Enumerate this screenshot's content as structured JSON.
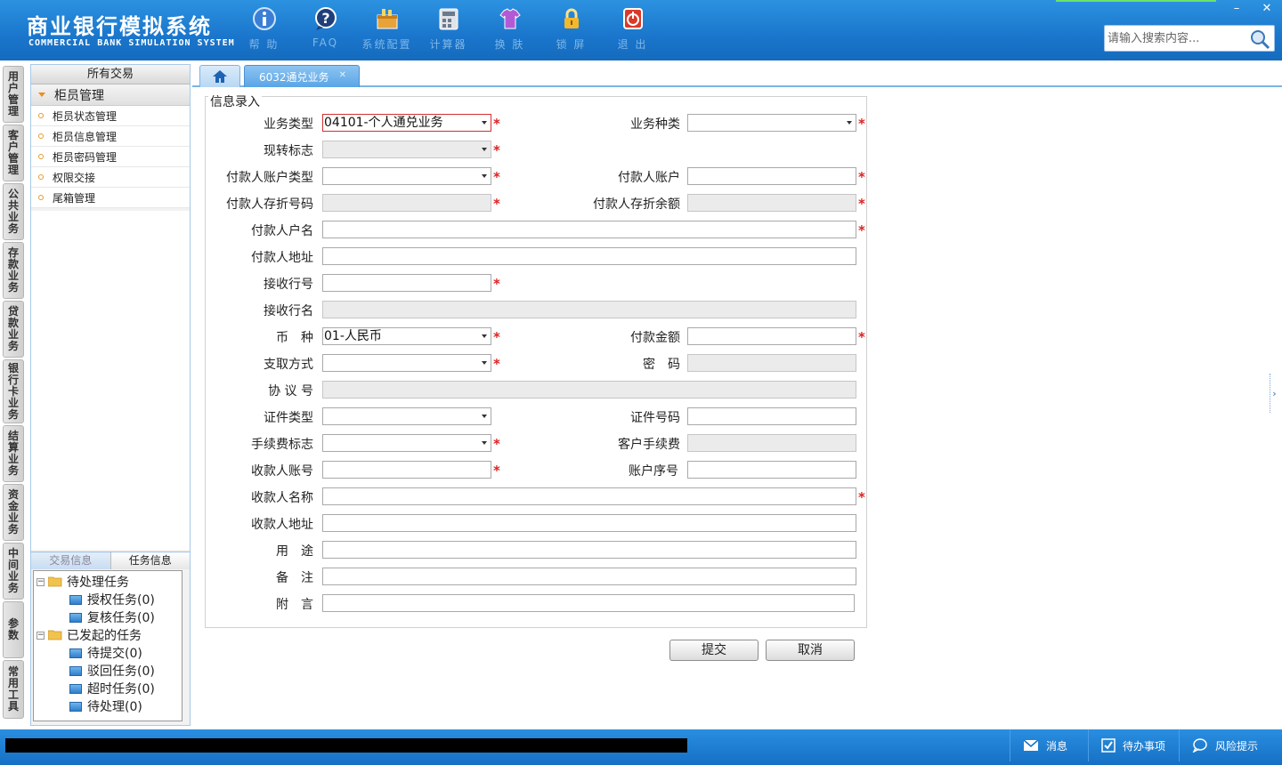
{
  "app": {
    "title": "商业银行模拟系统",
    "subtitle": "COMMERCIAL BANK SIMULATION SYSTEM"
  },
  "toolbar": [
    {
      "label": "帮 助",
      "icon": "help-icon"
    },
    {
      "label": "FAQ",
      "icon": "faq-icon"
    },
    {
      "label": "系统配置",
      "icon": "settings-icon"
    },
    {
      "label": "计算器",
      "icon": "calculator-icon"
    },
    {
      "label": "换 肤",
      "icon": "skin-icon"
    },
    {
      "label": "锁 屏",
      "icon": "lock-icon"
    },
    {
      "label": "退 出",
      "icon": "exit-icon"
    }
  ],
  "window_controls": {
    "minimize": "–",
    "close": "✕"
  },
  "search": {
    "placeholder": "请输入搜索内容...",
    "value": ""
  },
  "vertical_tabs": [
    {
      "label": "用户管理"
    },
    {
      "label": "客户管理"
    },
    {
      "label": "公共业务"
    },
    {
      "label": "存款业务"
    },
    {
      "label": "贷款业务"
    },
    {
      "label": "银行卡业务"
    },
    {
      "label": "结算业务"
    },
    {
      "label": "资金业务"
    },
    {
      "label": "中间业务"
    },
    {
      "label": "参数"
    },
    {
      "label": "常用工具"
    }
  ],
  "left_panel": {
    "header": "所有交易",
    "group": "柜员管理",
    "items": [
      {
        "label": "柜员状态管理"
      },
      {
        "label": "柜员信息管理"
      },
      {
        "label": "柜员密码管理"
      },
      {
        "label": "权限交接"
      },
      {
        "label": "尾箱管理"
      }
    ],
    "info_tabs": {
      "transaction": "交易信息",
      "task": "任务信息"
    },
    "tree": {
      "pending": {
        "label": "待处理任务",
        "children": [
          {
            "label": "授权任务(0)"
          },
          {
            "label": "复核任务(0)"
          }
        ]
      },
      "initiated": {
        "label": "已发起的任务",
        "children": [
          {
            "label": "待提交(0)"
          },
          {
            "label": "驳回任务(0)"
          },
          {
            "label": "超时任务(0)"
          },
          {
            "label": "待处理(0)"
          }
        ]
      }
    }
  },
  "tabs": {
    "home_icon": "home-icon",
    "active": {
      "label": "6032通兑业务",
      "close": "✕"
    }
  },
  "form": {
    "legend": "信息录入",
    "business_type": {
      "label": "业务类型",
      "value": "04101-个人通兑业务"
    },
    "business_kind": {
      "label": "业务种类",
      "value": ""
    },
    "cash_transfer_flag": {
      "label": "现转标志",
      "value": ""
    },
    "payer_account_type": {
      "label": "付款人账户类型",
      "value": ""
    },
    "payer_account": {
      "label": "付款人账户",
      "value": ""
    },
    "payer_passbook_no": {
      "label": "付款人存折号码",
      "value": ""
    },
    "payer_passbook_balance": {
      "label": "付款人存折余额",
      "value": ""
    },
    "payer_name": {
      "label": "付款人户名",
      "value": ""
    },
    "payer_address": {
      "label": "付款人地址",
      "value": ""
    },
    "receiving_bank_no": {
      "label": "接收行号",
      "value": ""
    },
    "receiving_bank_name": {
      "label": "接收行名",
      "value": ""
    },
    "currency": {
      "label": "币　种",
      "value": "01-人民币"
    },
    "payment_amount": {
      "label": "付款金额",
      "value": ""
    },
    "withdraw_method": {
      "label": "支取方式",
      "value": ""
    },
    "password": {
      "label": "密　码",
      "value": ""
    },
    "agreement_no": {
      "label": "协 议 号",
      "value": ""
    },
    "id_type": {
      "label": "证件类型",
      "value": ""
    },
    "id_number": {
      "label": "证件号码",
      "value": ""
    },
    "fee_flag": {
      "label": "手续费标志",
      "value": ""
    },
    "customer_fee": {
      "label": "客户手续费",
      "value": ""
    },
    "payee_account": {
      "label": "收款人账号",
      "value": ""
    },
    "account_seq": {
      "label": "账户序号",
      "value": ""
    },
    "payee_name": {
      "label": "收款人名称",
      "value": ""
    },
    "payee_address": {
      "label": "收款人地址",
      "value": ""
    },
    "purpose": {
      "label": "用　途",
      "value": ""
    },
    "remark": {
      "label": "备　注",
      "value": ""
    },
    "postscript": {
      "label": "附　言",
      "value": ""
    },
    "required_mark": "*",
    "submit_label": "提交",
    "cancel_label": "取消"
  },
  "right_handle": "›",
  "status_bar": {
    "messages": "消息",
    "todo": "待办事项",
    "risk": "风险提示"
  }
}
